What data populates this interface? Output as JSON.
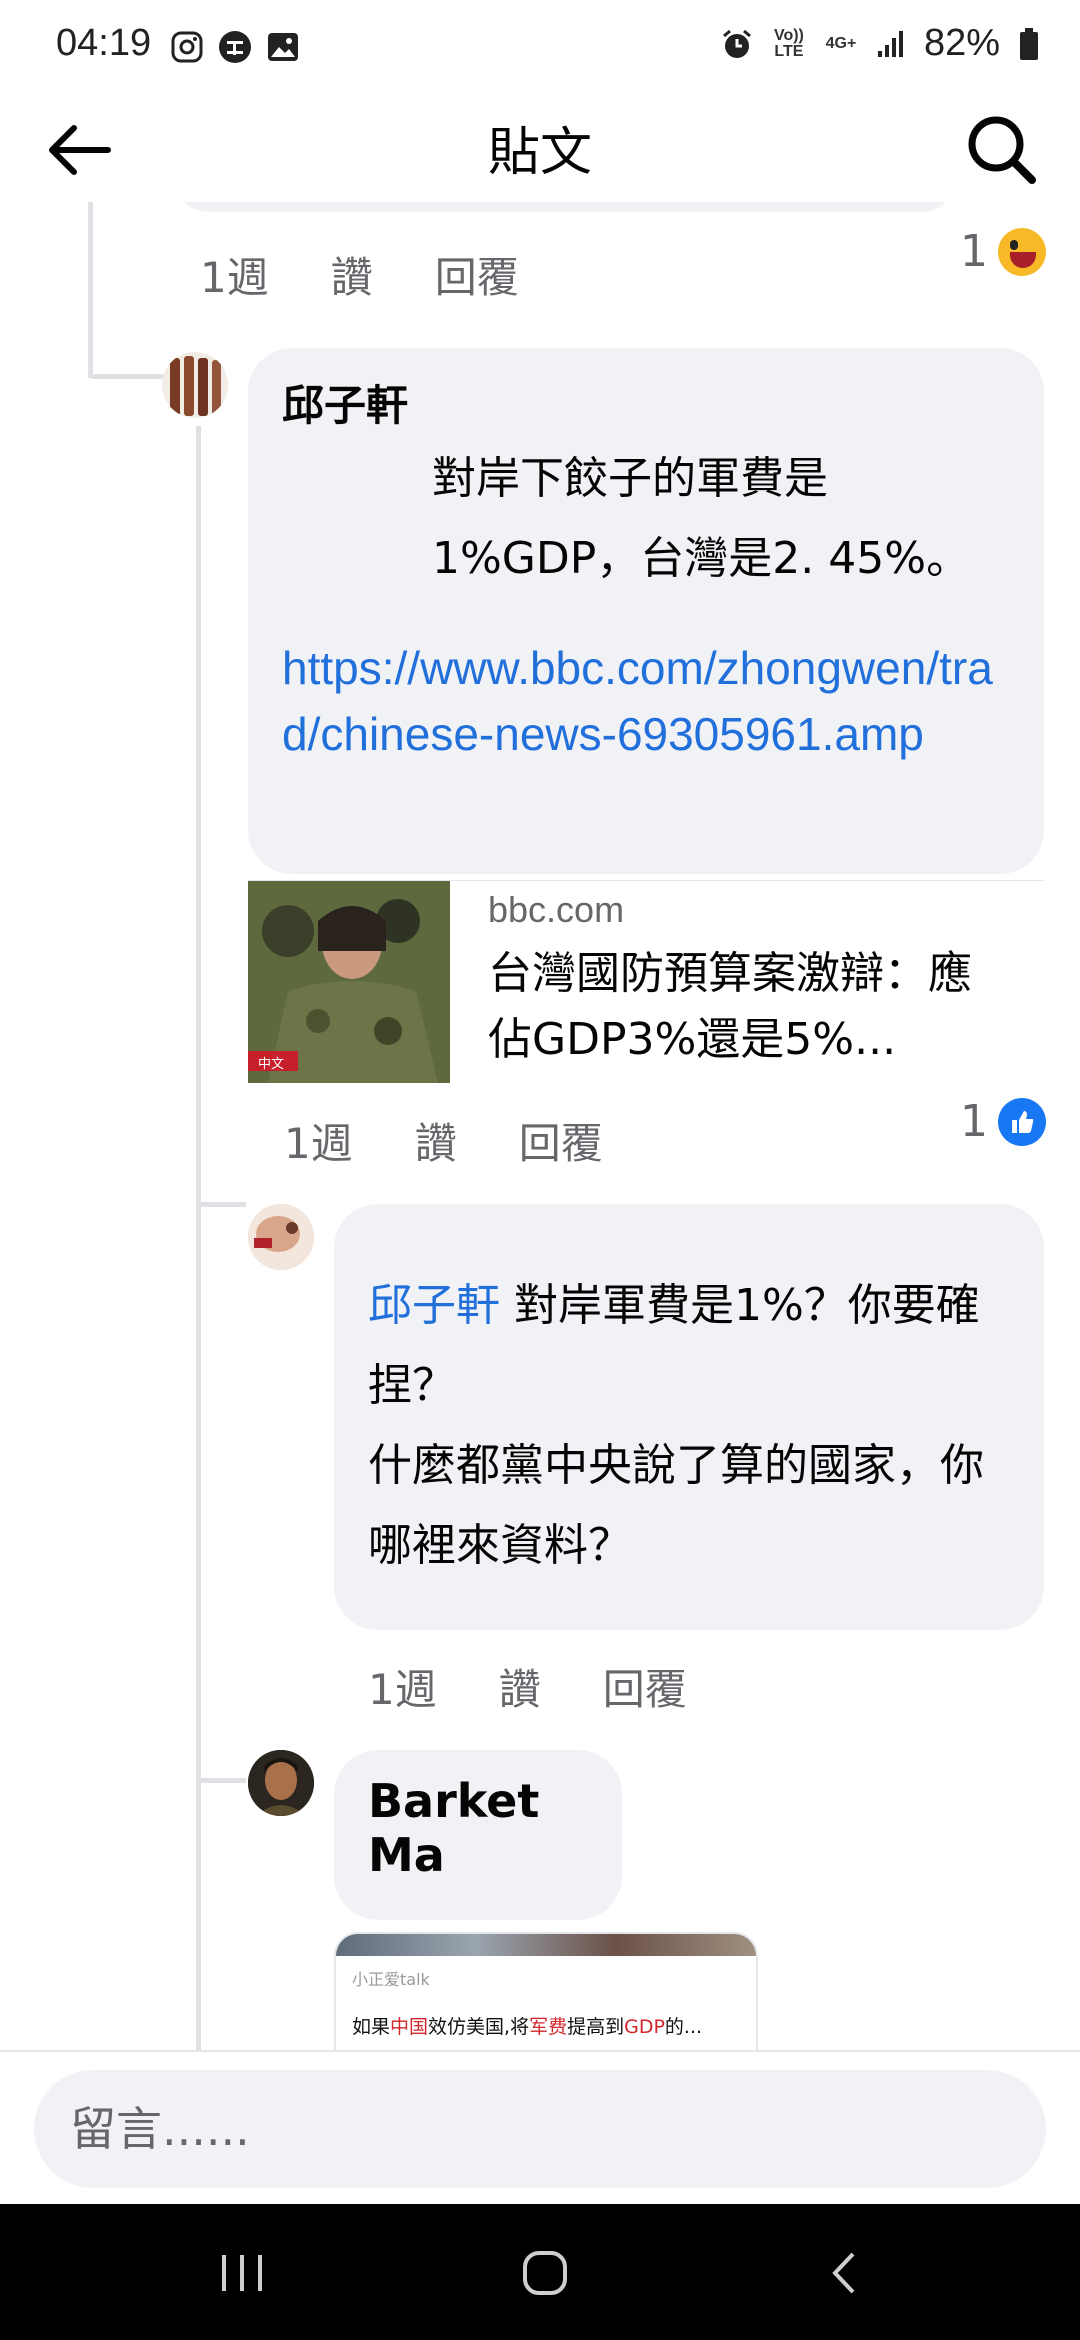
{
  "status_bar": {
    "time": "04:19",
    "battery": "82%",
    "volte": "Vo)) LTE",
    "net": "4G+"
  },
  "header": {
    "title": "貼文"
  },
  "thread": {
    "prev_comment": {
      "time": "1週",
      "like_label": "讚",
      "reply_label": "回覆",
      "reaction_count": "1",
      "reaction_icon": "haha-emoji-icon"
    },
    "comment_1": {
      "author": "邱子軒",
      "text": "對岸下餃子的軍費是1%GDP，台灣是2. 45%。",
      "link": "https://www.bbc.com/zhongwen/trad/chinese-news-69305961.amp",
      "preview_domain": "bbc.com",
      "preview_title": "台灣國防預算案激辯：應佔GDP3%還是5%...",
      "preview_badge": "中文",
      "time": "1週",
      "like_label": "讚",
      "reply_label": "回覆",
      "reaction_count": "1",
      "reaction_icon": "like-icon"
    },
    "reply_1": {
      "mention": "邱子軒",
      "text": " 對岸軍費是1%？你要確捏？",
      "text2": "什麼都黨中央說了算的國家，你哪裡來資料？",
      "time": "1週",
      "like_label": "讚",
      "reply_label": "回覆"
    },
    "reply_2": {
      "author": "Barket Ma",
      "shared_source": "小正爱talk",
      "shared_title": {
        "p1": "如果",
        "p2": "中国",
        "p3": "效仿美国,将",
        "p4": "军费",
        "p5": "提高到",
        "p6": "GDP",
        "p7": "的..."
      }
    }
  },
  "composer": {
    "placeholder": "留言......"
  },
  "colors": {
    "link": "#216fdb",
    "bubble": "#f0f2f5",
    "meta": "#65676b",
    "like_blue": "#1877f2"
  }
}
